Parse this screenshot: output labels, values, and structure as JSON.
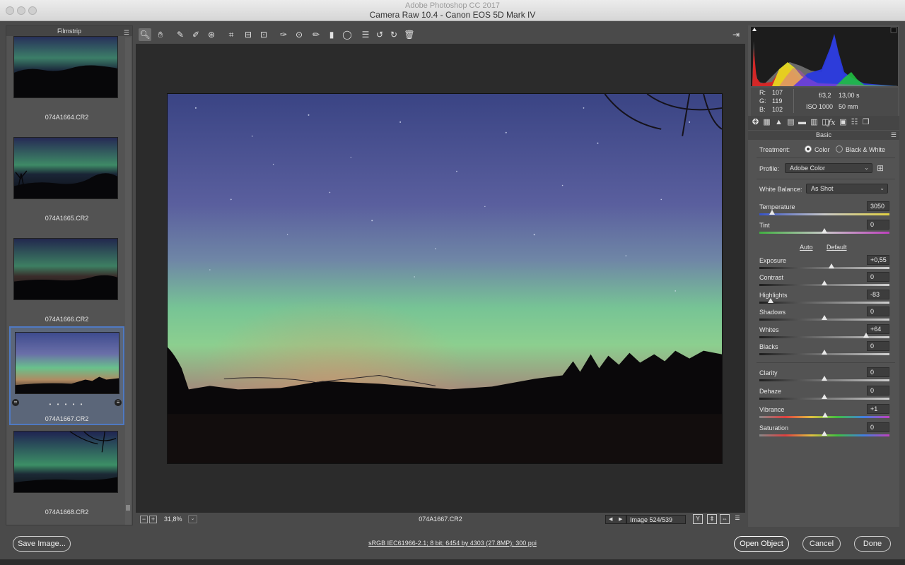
{
  "window": {
    "app_title": "Adobe Photoshop CC 2017",
    "title": "Camera Raw 10.4  -  Canon EOS 5D Mark IV"
  },
  "filmstrip": {
    "title": "Filmstrip",
    "items": [
      {
        "label": "074A1664.CR2"
      },
      {
        "label": "074A1665.CR2"
      },
      {
        "label": "074A1666.CR2"
      },
      {
        "label": "074A1667.CR2",
        "selected": true,
        "dots": "• • • • •"
      },
      {
        "label": "074A1668.CR2"
      }
    ]
  },
  "toolbar": {
    "tools": [
      {
        "name": "zoom-tool",
        "icon": "magnifier-icon",
        "glyph": "🔍︎",
        "active": true
      },
      {
        "name": "hand-tool",
        "icon": "hand-icon",
        "glyph": "✋︎"
      },
      {
        "name": "white-balance-tool",
        "icon": "eyedropper-icon",
        "glyph": "✎"
      },
      {
        "name": "color-sampler-tool",
        "icon": "color-sampler-icon",
        "glyph": "✐"
      },
      {
        "name": "targeted-adjustment-tool",
        "icon": "target-adjust-icon",
        "glyph": "⊛"
      },
      {
        "name": "crop-tool",
        "icon": "crop-icon",
        "glyph": "⌗"
      },
      {
        "name": "straighten-tool",
        "icon": "straighten-icon",
        "glyph": "⊟"
      },
      {
        "name": "transform-tool",
        "icon": "transform-icon",
        "glyph": "⊡"
      },
      {
        "name": "spot-removal-tool",
        "icon": "spot-removal-icon",
        "glyph": "✑"
      },
      {
        "name": "red-eye-tool",
        "icon": "red-eye-icon",
        "glyph": "⊙"
      },
      {
        "name": "adjustment-brush-tool",
        "icon": "brush-icon",
        "glyph": "✏"
      },
      {
        "name": "graduated-filter-tool",
        "icon": "graduated-filter-icon",
        "glyph": "▮"
      },
      {
        "name": "radial-filter-tool",
        "icon": "radial-filter-icon",
        "glyph": "◯"
      },
      {
        "name": "preferences-tool",
        "icon": "list-icon",
        "glyph": "☰"
      },
      {
        "name": "rotate-left-tool",
        "icon": "rotate-left-icon",
        "glyph": "↺"
      },
      {
        "name": "rotate-right-tool",
        "icon": "rotate-right-icon",
        "glyph": "↻"
      },
      {
        "name": "delete-tool",
        "icon": "trash-icon",
        "glyph": "🗑︎"
      }
    ],
    "fullscreen_icon": "fullscreen-icon"
  },
  "viewbar": {
    "zoom_out": "−",
    "zoom_in": "+",
    "zoom": "31,8%",
    "zoom_dd": "⌄",
    "filename": "074A1667.CR2",
    "prev": "◀",
    "next": "▶",
    "image_count": "Image 524/539",
    "view_y": "Y",
    "view_compare": "⇕",
    "view_swap": "⇔",
    "view_settings": "☰"
  },
  "readout": {
    "r_label": "R:",
    "r": "107",
    "g_label": "G:",
    "g": "119",
    "b_label": "B:",
    "b": "102",
    "aperture": "f/3,2",
    "shutter": "13,00 s",
    "iso": "ISO 1000",
    "focal": "50 mm"
  },
  "panel": {
    "title": "Basic",
    "treatment_label": "Treatment:",
    "treatment_color": "Color",
    "treatment_bw": "Black & White",
    "profile_label": "Profile:",
    "profile_value": "Adobe Color",
    "wb_label": "White Balance:",
    "wb_value": "As Shot",
    "auto": "Auto",
    "default": "Default",
    "sliders": [
      {
        "name": "temperature",
        "label": "Temperature",
        "value": "3050",
        "pos": 0.1
      },
      {
        "name": "tint",
        "label": "Tint",
        "value": "0",
        "pos": 0.5
      },
      {
        "name": "exposure",
        "label": "Exposure",
        "value": "+0,55",
        "pos": 0.555
      },
      {
        "name": "contrast",
        "label": "Contrast",
        "value": "0",
        "pos": 0.5
      },
      {
        "name": "highlights",
        "label": "Highlights",
        "value": "-83",
        "pos": 0.085
      },
      {
        "name": "shadows",
        "label": "Shadows",
        "value": "0",
        "pos": 0.5
      },
      {
        "name": "whites",
        "label": "Whites",
        "value": "+64",
        "pos": 0.82
      },
      {
        "name": "blacks",
        "label": "Blacks",
        "value": "0",
        "pos": 0.5
      },
      {
        "name": "clarity",
        "label": "Clarity",
        "value": "0",
        "pos": 0.5
      },
      {
        "name": "dehaze",
        "label": "Dehaze",
        "value": "0",
        "pos": 0.5
      },
      {
        "name": "vibrance",
        "label": "Vibrance",
        "value": "+1",
        "pos": 0.503
      },
      {
        "name": "saturation",
        "label": "Saturation",
        "value": "0",
        "pos": 0.5
      }
    ]
  },
  "bottom": {
    "save": "Save Image...",
    "workflow": "sRGB IEC61966-2.1; 8 bit; 6454 by 4303 (27.8MP); 300 ppi",
    "open": "Open Object",
    "cancel": "Cancel",
    "done": "Done"
  }
}
